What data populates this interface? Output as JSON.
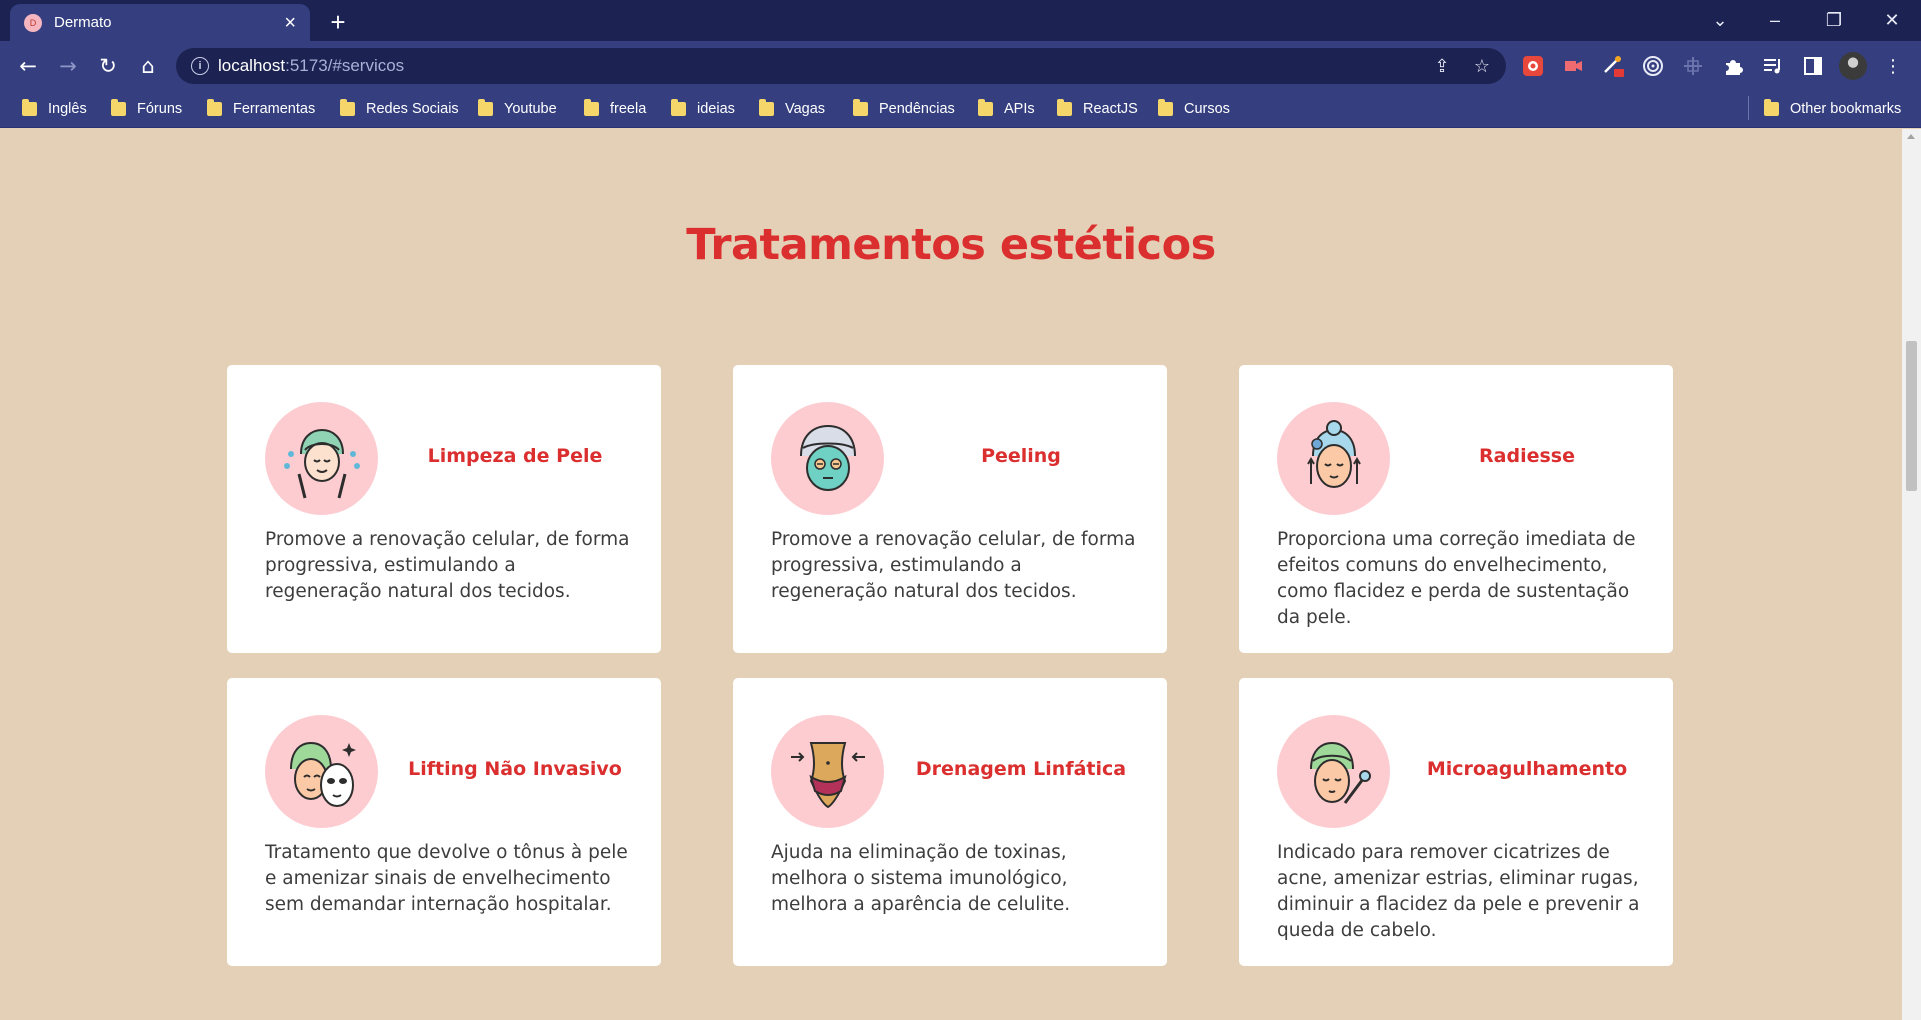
{
  "browser": {
    "tab_title": "Dermato",
    "tab_favicon_letter": "D",
    "url_host": "localhost",
    "url_rest": ":5173/#servicos",
    "bookmarks": [
      "Inglês",
      "Fóruns",
      "Ferramentas",
      "Redes Sociais",
      "Youtube",
      "freela",
      "ideias",
      "Vagas",
      "Pendências",
      "APIs",
      "ReactJS",
      "Cursos"
    ],
    "other_bookmarks": "Other bookmarks"
  },
  "page": {
    "section_title": "Tratamentos estéticos",
    "accent_color": "#db2e2e",
    "background_color": "#e4d0b6",
    "icon_circle_color": "#fdccd1",
    "services": [
      {
        "title": "Limpeza de Pele",
        "icon": "face-cleansing-icon",
        "description": "Promove a renovação celular, de forma progressiva, estimulando a regeneração natural dos tecidos."
      },
      {
        "title": "Peeling",
        "icon": "face-mask-icon",
        "description": "Promove a renovação celular, de forma progressiva, estimulando a regeneração natural dos tecidos."
      },
      {
        "title": "Radiesse",
        "icon": "face-lift-icon",
        "description": "Proporciona uma correção imediata de efeitos comuns do envelhecimento, como flacidez e perda de sustentação da pele."
      },
      {
        "title": "Lifting Não Invasivo",
        "icon": "sheet-mask-icon",
        "description": "Tratamento que devolve o tônus à pele e amenizar sinais de envelhecimento sem demandar internação hospitalar."
      },
      {
        "title": "Drenagem Linfática",
        "icon": "body-drainage-icon",
        "description": "Ajuda na eliminação de toxinas, melhora o sistema imunológico, melhora a aparência de celulite."
      },
      {
        "title": "Microagulhamento",
        "icon": "microneedling-icon",
        "description": "Indicado para remover cicatrizes de acne, amenizar estrias, eliminar rugas, diminuir a flacidez da pele e prevenir a queda de cabelo."
      }
    ]
  }
}
